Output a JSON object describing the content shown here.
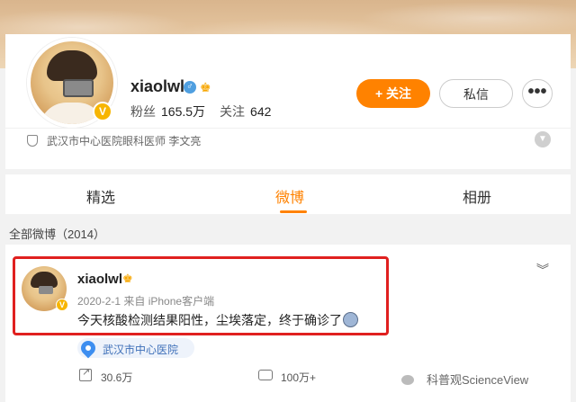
{
  "profile": {
    "name": "xiaolwl",
    "gender_icon": "male-icon",
    "fans_label": "粉丝",
    "fans_count": "165.5万",
    "follows_label": "关注",
    "follows_count": "642",
    "follow_button": "+ 关注",
    "message_button": "私信",
    "more_button": "•••",
    "verify_text": "武汉市中心医院眼科医师 李文亮",
    "vip_badge": "V"
  },
  "tabs": [
    {
      "label": "精选",
      "active": false
    },
    {
      "label": "微博",
      "active": true
    },
    {
      "label": "相册",
      "active": false
    }
  ],
  "posts_header": "全部微博（2014）",
  "post": {
    "name": "xiaolwl",
    "meta": "2020-2-1 来自 iPhone客户端",
    "text": "今天核酸检测结果阳性，尘埃落定，终于确诊了",
    "location": "武汉市中心医院",
    "reposts": "30.6万",
    "comments": "100万+"
  },
  "watermark": {
    "text": "科普观ScienceView"
  },
  "colors": {
    "accent": "#ff8200",
    "highlight_border": "#e0201f",
    "link": "#3d6fb8"
  }
}
